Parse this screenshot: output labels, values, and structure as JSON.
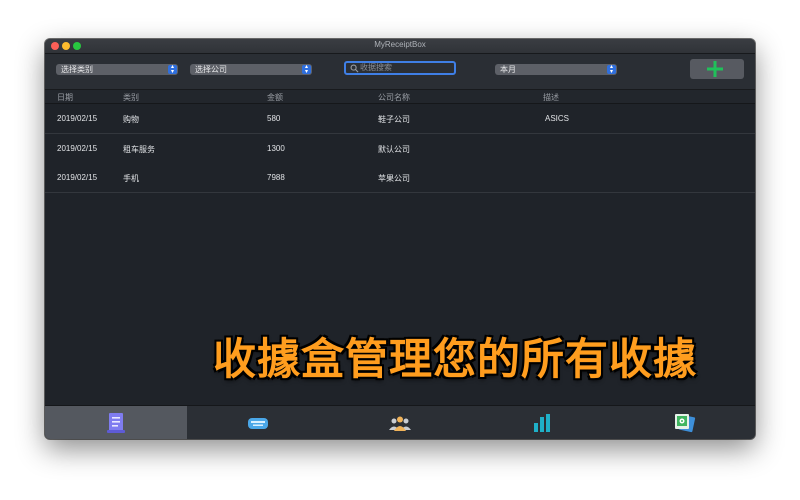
{
  "window": {
    "title": "MyReceiptBox"
  },
  "toolbar": {
    "category_select": {
      "value": "选择类别"
    },
    "company_select": {
      "value": "选择公司"
    },
    "search": {
      "placeholder": "收据搜索"
    },
    "period_select": {
      "value": "本月"
    },
    "add_button": {
      "icon": "plus-icon",
      "color": "#20c05a"
    }
  },
  "table": {
    "columns": [
      "日期",
      "类别",
      "金额",
      "公司名称",
      "描述"
    ],
    "rows": [
      [
        "2019/02/15",
        "购物",
        "580",
        "鞋子公司",
        "ASICS"
      ],
      [
        "2019/02/15",
        "租车服务",
        "1300",
        "默认公司",
        ""
      ],
      [
        "2019/02/15",
        "手机",
        "7988",
        "苹果公司",
        ""
      ]
    ]
  },
  "overlay": {
    "caption": "收據盒管理您的所有收據",
    "color": "#ff9d1e"
  },
  "tabbar": {
    "active_index": 0,
    "tabs": [
      {
        "icon": "receipt-icon"
      },
      {
        "icon": "payment-card-icon"
      },
      {
        "icon": "people-icon"
      },
      {
        "icon": "bar-chart-icon"
      },
      {
        "icon": "photo-stack-icon"
      }
    ]
  }
}
